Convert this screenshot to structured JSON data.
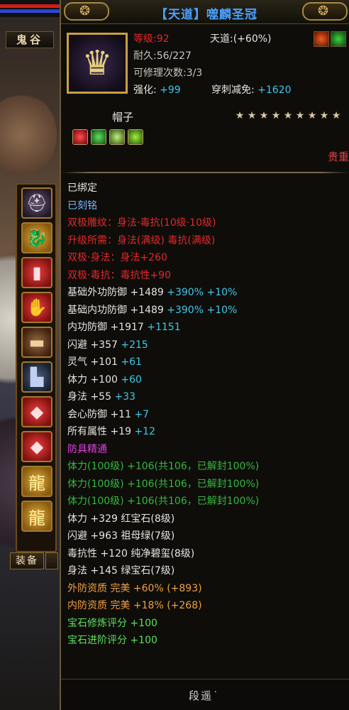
{
  "left_panel": {
    "tab_top": "鬼谷",
    "tab_bottom": "装备",
    "slots": [
      {
        "icon": "helmet-icon",
        "style": "dark",
        "glyph": "⛑"
      },
      {
        "icon": "dragon-icon",
        "style": "gold",
        "glyph": "🐉"
      },
      {
        "icon": "bracer-icon",
        "style": "red",
        "glyph": "▮"
      },
      {
        "icon": "glove-icon",
        "style": "red",
        "glyph": "✋"
      },
      {
        "icon": "belt-icon",
        "style": "brown",
        "glyph": "▬"
      },
      {
        "icon": "boots-icon",
        "style": "blue",
        "glyph": "▙"
      },
      {
        "icon": "red-amulet-icon",
        "style": "red",
        "glyph": "◆"
      },
      {
        "icon": "red-amulet-icon",
        "style": "red",
        "glyph": "◆"
      },
      {
        "icon": "gold-dragon-icon",
        "style": "gold",
        "glyph": "龍"
      },
      {
        "icon": "gold-dragon-icon",
        "style": "gold",
        "glyph": "龍"
      }
    ]
  },
  "tooltip": {
    "title": "【天道】噬麟圣冠",
    "level": "等级:92",
    "tiandao": "天道:(+60%)",
    "durability": "耐久:56/227",
    "repair": "可修理次数:3/3",
    "enhance_label": "强化:",
    "enhance_value": "+99",
    "pierce_label": "穿刺减免:",
    "pierce_value": "+1620",
    "item_type": "帽子",
    "star_count": 9,
    "rarity_label": "贵重",
    "colors": {
      "title": "#48a0ff",
      "red_text": "#e02a2a",
      "white_text": "#e8e4dc",
      "blue_text": "#7ab8ff",
      "cyan_value": "#3ec8e8",
      "magenta_text": "#e040e0",
      "green_text": "#34b83c",
      "gem_green": "#5ce05c",
      "orange_text": "#f0a040"
    },
    "lines": [
      {
        "parts": [
          {
            "t": "已绑定",
            "c": "white_text"
          }
        ]
      },
      {
        "parts": [
          {
            "t": "已刻铭",
            "c": "blue_text"
          }
        ]
      },
      {
        "parts": [
          {
            "t": "双极雕纹：身法·毒抗(10级·10级)",
            "c": "red_text"
          }
        ]
      },
      {
        "parts": [
          {
            "t": "升级所需：身法(满级)  毒抗(满级)",
            "c": "red_text"
          }
        ]
      },
      {
        "parts": [
          {
            "t": "双极·身法：身法+260",
            "c": "red_text"
          }
        ]
      },
      {
        "parts": [
          {
            "t": "双极·毒抗：毒抗性+90",
            "c": "red_text"
          }
        ]
      },
      {
        "parts": [
          {
            "t": "基础外功防御 +1489 ",
            "c": "white_text"
          },
          {
            "t": "+390% +10%",
            "c": "cyan_value"
          }
        ]
      },
      {
        "parts": [
          {
            "t": "基础内功防御 +1489 ",
            "c": "white_text"
          },
          {
            "t": "+390% +10%",
            "c": "cyan_value"
          }
        ]
      },
      {
        "parts": [
          {
            "t": "内功防御 +1917 ",
            "c": "white_text"
          },
          {
            "t": "+1151",
            "c": "cyan_value"
          }
        ]
      },
      {
        "parts": [
          {
            "t": "闪避 +357 ",
            "c": "white_text"
          },
          {
            "t": "+215",
            "c": "cyan_value"
          }
        ]
      },
      {
        "parts": [
          {
            "t": "灵气 +101 ",
            "c": "white_text"
          },
          {
            "t": "+61",
            "c": "cyan_value"
          }
        ]
      },
      {
        "parts": [
          {
            "t": "体力 +100 ",
            "c": "white_text"
          },
          {
            "t": "+60",
            "c": "cyan_value"
          }
        ]
      },
      {
        "parts": [
          {
            "t": "身法 +55 ",
            "c": "white_text"
          },
          {
            "t": "+33",
            "c": "cyan_value"
          }
        ]
      },
      {
        "parts": [
          {
            "t": "会心防御 +11 ",
            "c": "white_text"
          },
          {
            "t": "+7",
            "c": "cyan_value"
          }
        ]
      },
      {
        "parts": [
          {
            "t": "所有属性 +19 ",
            "c": "white_text"
          },
          {
            "t": "+12",
            "c": "cyan_value"
          }
        ]
      },
      {
        "parts": [
          {
            "t": "防具精通",
            "c": "magenta_text"
          }
        ]
      },
      {
        "parts": [
          {
            "t": "体力(100级) +106(共106，已解封100%)",
            "c": "green_text"
          }
        ]
      },
      {
        "parts": [
          {
            "t": "体力(100级) +106(共106，已解封100%)",
            "c": "green_text"
          }
        ]
      },
      {
        "parts": [
          {
            "t": "体力(100级) +106(共106，已解封100%)",
            "c": "green_text"
          }
        ]
      },
      {
        "parts": [
          {
            "t": "体力 +329 红宝石(8级)",
            "c": "white_text"
          }
        ]
      },
      {
        "parts": [
          {
            "t": "闪避 +963 祖母绿(7级)",
            "c": "white_text"
          }
        ]
      },
      {
        "parts": [
          {
            "t": "毒抗性 +120 纯净碧玺(8级)",
            "c": "white_text"
          }
        ]
      },
      {
        "parts": [
          {
            "t": "身法 +145 绿宝石(7级)",
            "c": "white_text"
          }
        ]
      },
      {
        "parts": [
          {
            "t": "外防资质   完美 +60% (+893)",
            "c": "orange_text"
          }
        ]
      },
      {
        "parts": [
          {
            "t": "内防资质   完美 +18% (+268)",
            "c": "orange_text"
          }
        ]
      },
      {
        "parts": [
          {
            "t": "宝石修炼评分 +100",
            "c": "gem_green"
          }
        ]
      },
      {
        "parts": [
          {
            "t": "宝石进阶评分 +100",
            "c": "gem_green"
          }
        ]
      }
    ],
    "owner_name": "段遥˙"
  }
}
